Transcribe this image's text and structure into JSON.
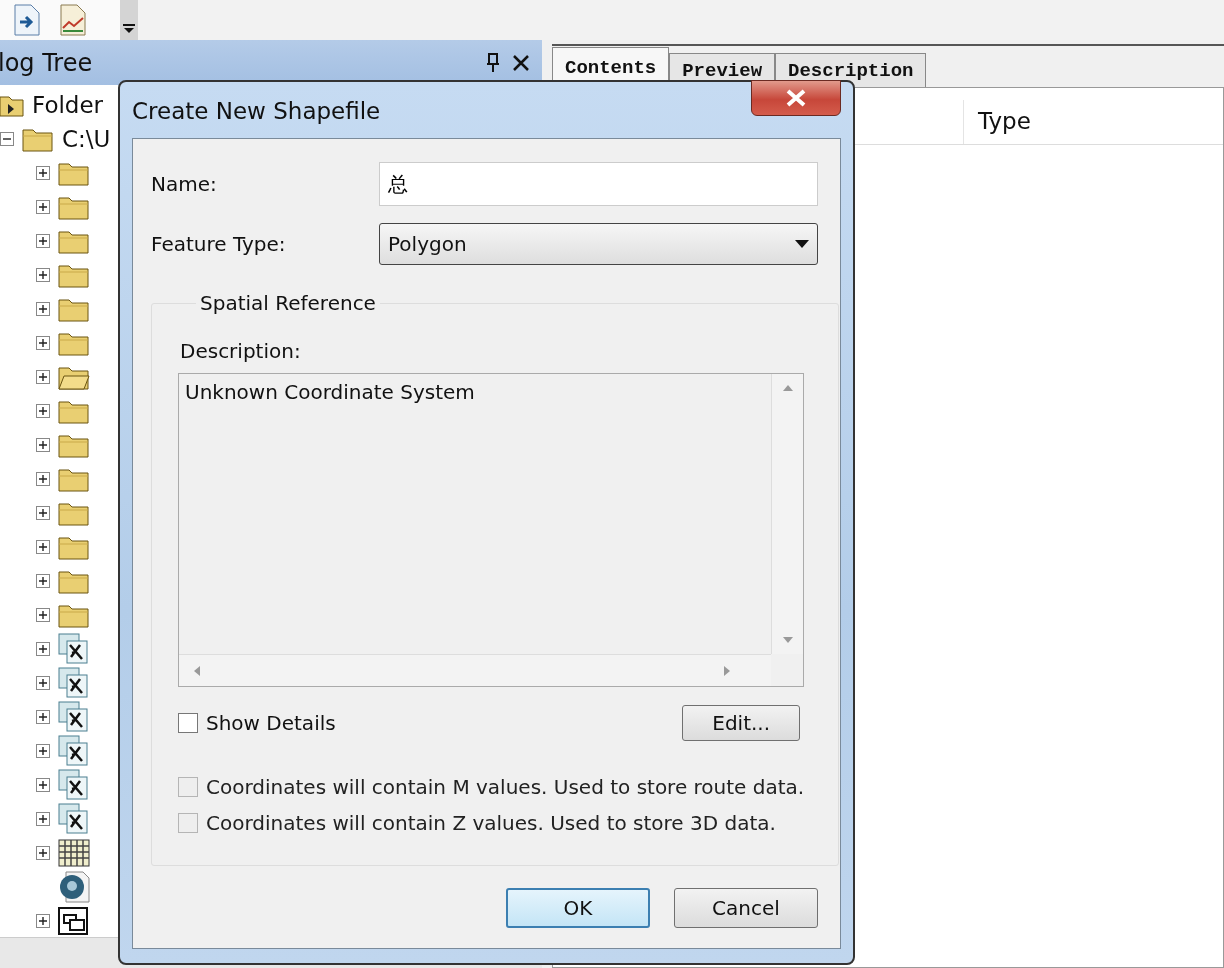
{
  "catalog_tree": {
    "title": "log Tree",
    "items": [
      {
        "label": "Folder",
        "kind": "connection"
      },
      {
        "label": "C:\\U",
        "kind": "folder",
        "expanded": true,
        "children": [
          {
            "kind": "folder",
            "expanded": false
          },
          {
            "kind": "folder",
            "expanded": false
          },
          {
            "kind": "folder",
            "expanded": false
          },
          {
            "kind": "folder",
            "expanded": false
          },
          {
            "kind": "folder",
            "expanded": false
          },
          {
            "kind": "folder",
            "expanded": false
          },
          {
            "kind": "folder_open",
            "expanded": false
          },
          {
            "kind": "folder",
            "expanded": false
          },
          {
            "kind": "folder",
            "expanded": false
          },
          {
            "kind": "folder",
            "expanded": false
          },
          {
            "kind": "folder",
            "expanded": false
          },
          {
            "kind": "folder",
            "expanded": false
          },
          {
            "kind": "folder",
            "expanded": false
          },
          {
            "kind": "folder",
            "expanded": false
          },
          {
            "kind": "map",
            "expanded": false
          },
          {
            "kind": "map",
            "expanded": false
          },
          {
            "kind": "map",
            "expanded": false
          },
          {
            "kind": "map",
            "expanded": false
          },
          {
            "kind": "map",
            "expanded": false
          },
          {
            "kind": "map",
            "expanded": false
          },
          {
            "kind": "raster",
            "expanded": false
          },
          {
            "kind": "layer_file"
          },
          {
            "kind": "toolbox",
            "expanded": false
          }
        ]
      }
    ]
  },
  "tabs": [
    {
      "label": "Contents",
      "selected": true
    },
    {
      "label": "Preview",
      "selected": false
    },
    {
      "label": "Description",
      "selected": false
    }
  ],
  "contents": {
    "columns": [
      "Type"
    ]
  },
  "dialog": {
    "title": "Create New Shapefile",
    "name_label": "Name:",
    "name_value": "总",
    "feature_type_label": "Feature Type:",
    "feature_type_value": "Polygon",
    "spatial_reference": {
      "title": "Spatial Reference",
      "description_label": "Description:",
      "description": "Unknown Coordinate System"
    },
    "show_details": {
      "label": "Show Details",
      "checked": false
    },
    "edit_button": "Edit...",
    "options": [
      {
        "label": "Coordinates will contain M values. Used to store route data.",
        "checked": false,
        "disabled": true
      },
      {
        "label": "Coordinates will contain Z values. Used to store 3D data.",
        "checked": false,
        "disabled": true
      }
    ],
    "buttons": [
      {
        "label": "OK",
        "default": true
      },
      {
        "label": "Cancel",
        "default": false
      }
    ]
  }
}
